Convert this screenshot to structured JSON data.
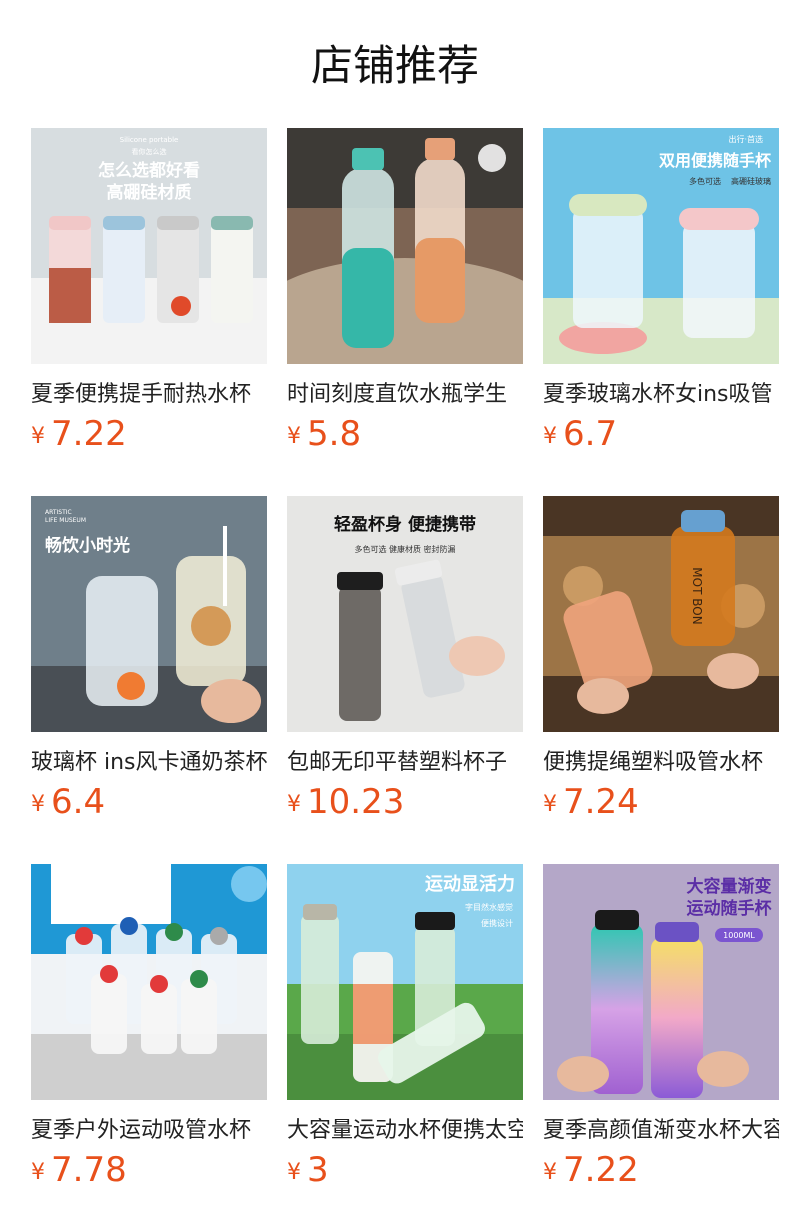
{
  "page": {
    "title": "店铺推荐"
  },
  "products": [
    {
      "name": "夏季便携提手耐热水杯",
      "currency": "¥",
      "price": "7.22",
      "image_text": [
        "怎么选都好看",
        "高硼硅材质",
        "Silicone portable",
        "看你怎么选"
      ],
      "image_bg": "#cfd8dc"
    },
    {
      "name": "时间刻度直饮水瓶学生",
      "currency": "¥",
      "price": "5.8",
      "image_text": [],
      "image_bg": "#8d6e5a"
    },
    {
      "name": "夏季玻璃水杯女ins吸管",
      "currency": "¥",
      "price": "6.7",
      "image_text": [
        "双用便携随手杯",
        "出行·首选",
        "多色可选",
        "高硼硅玻璃"
      ],
      "image_bg": "#6ec1e4"
    },
    {
      "name": "玻璃杯 ins风卡通奶茶杯",
      "currency": "¥",
      "price": "6.4",
      "image_text": [
        "畅饮小时光",
        "ARTISTIC",
        "LIFE MUSEUM"
      ],
      "image_bg": "#7d8f9b"
    },
    {
      "name": "包邮无印平替塑料杯子",
      "currency": "¥",
      "price": "10.23",
      "image_text": [
        "轻盈杯身 便捷携带",
        "多色可选 健康材质 密封防漏"
      ],
      "image_bg": "#e4e4e2"
    },
    {
      "name": "便携提绳塑料吸管水杯",
      "currency": "¥",
      "price": "7.24",
      "image_text": [
        "MOT BON"
      ],
      "image_bg": "#6b4a2e"
    },
    {
      "name": "夏季户外运动吸管水杯",
      "currency": "¥",
      "price": "7.78",
      "image_text": [],
      "image_bg": "#eef2f5"
    },
    {
      "name": "大容量运动水杯便携太空杯",
      "currency": "¥",
      "price": "3",
      "image_text": [
        "运动显活力",
        "字目然水感觉",
        "便携设计"
      ],
      "image_bg": "#8fd0ec"
    },
    {
      "name": "夏季高颜值渐变水杯大容量",
      "currency": "¥",
      "price": "7.22",
      "image_text": [
        "大容量渐变",
        "运动随手杯",
        "1000ML"
      ],
      "image_bg": "#b3a1c9"
    }
  ],
  "colors": {
    "price": "#e8501b",
    "title": "#111111",
    "name": "#222222"
  }
}
